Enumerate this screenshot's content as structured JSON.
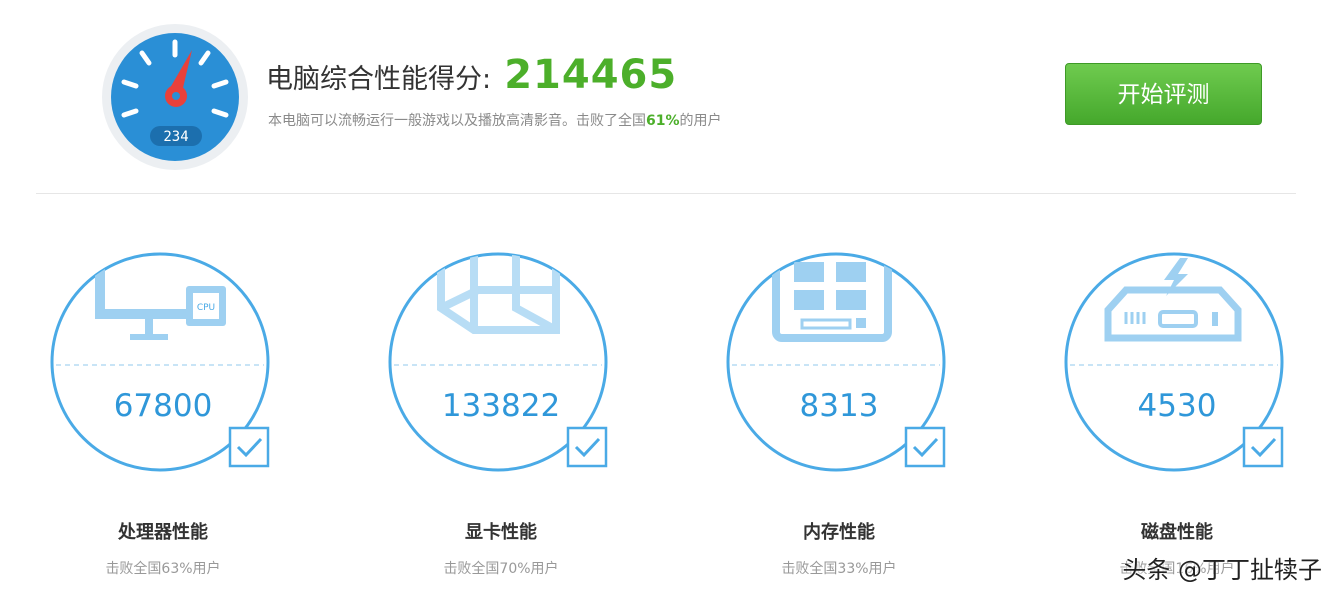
{
  "header": {
    "gauge_readout": "234",
    "title": "电脑综合性能得分:",
    "total_score": "214465",
    "subtitle_pre": "本电脑可以流畅运行一般游戏以及播放高清影音。击败了全国",
    "subtitle_pct": "61%",
    "subtitle_post": "的用户",
    "start_button": "开始评测"
  },
  "cards": [
    {
      "icon": "monitor-cpu-icon",
      "icon_label": "CPU",
      "score": "67800",
      "name": "处理器性能",
      "desc": "击败全国63%用户",
      "checked": true
    },
    {
      "icon": "graphics-card-cube-icon",
      "score": "133822",
      "name": "显卡性能",
      "desc": "击败全国70%用户",
      "checked": true
    },
    {
      "icon": "memory-module-icon",
      "score": "8313",
      "name": "内存性能",
      "desc": "击败全国33%用户",
      "checked": true
    },
    {
      "icon": "hard-disk-icon",
      "score": "4530",
      "name": "磁盘性能",
      "desc": "击败全国16%用户",
      "checked": true
    }
  ],
  "watermark": "头条 @丁丁扯犊子",
  "colors": {
    "accent_blue": "#2f97d9",
    "circle_blue": "#4aaae6",
    "green": "#4caf2a"
  }
}
